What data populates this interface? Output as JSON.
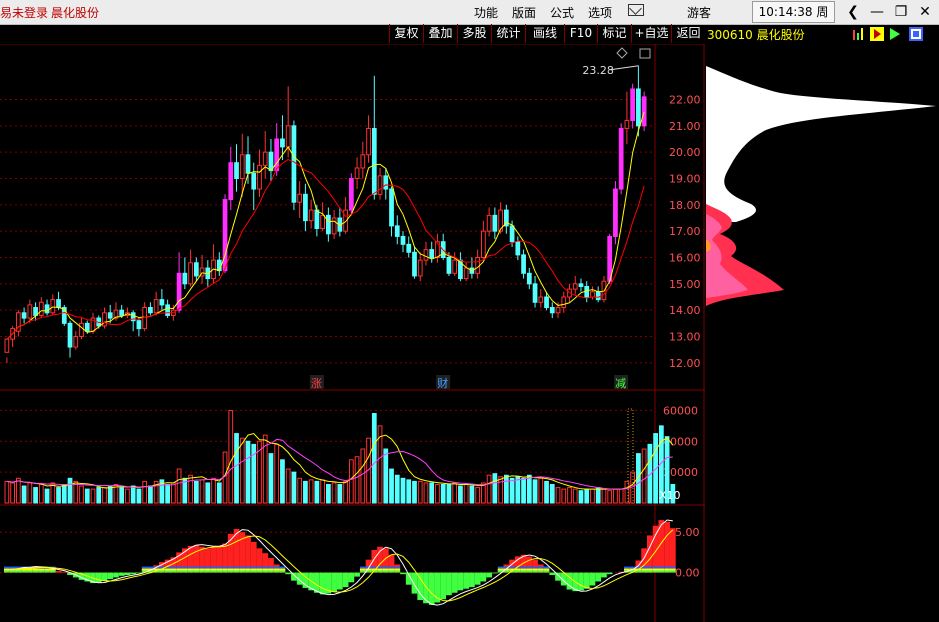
{
  "titlebar": {
    "login_text": "易未登录",
    "stock_name": "晨化股份",
    "menu": [
      "功能",
      "版面",
      "公式",
      "选项"
    ],
    "guest": "游客",
    "time": "10:14:38",
    "weekday": "周五"
  },
  "toolbar": {
    "buttons": [
      "复权",
      "叠加",
      "多股",
      "统计",
      "画线",
      "F10",
      "标记",
      "+自选",
      "返回"
    ]
  },
  "right_panel": {
    "code": "300610",
    "name": "晨化股份"
  },
  "price_axis": {
    "labels": [
      "22.00",
      "21.00",
      "20.00",
      "19.00",
      "18.00",
      "17.00",
      "16.00",
      "15.00",
      "14.00",
      "13.00",
      "12.00"
    ]
  },
  "max_price_label": "23.28",
  "event_markers": [
    {
      "text": "涨",
      "color": "#ff4040"
    },
    {
      "text": "财",
      "color": "#40a0ff"
    },
    {
      "text": "减",
      "color": "#40ff40"
    }
  ],
  "volume_axis": {
    "labels": [
      "60000",
      "40000",
      "20000"
    ],
    "unit": "X10"
  },
  "macd_axis": {
    "labels": [
      "5.00",
      "0.00"
    ]
  },
  "colors": {
    "up": "#ff3232",
    "up_fill_big": "#ff30ff",
    "down": "#54ffff",
    "ma5": "#ffff00",
    "ma10": "#ff0000",
    "vol_ma1": "#ffff00",
    "vol_ma2": "#ff40ff",
    "grid": "#800000"
  },
  "chart_data": [
    {
      "type": "candlestick",
      "title": "",
      "ylim": [
        11.5,
        23.5
      ],
      "series": [
        {
          "name": "",
          "values": [
            [
              12.4,
              12.9,
              12.2,
              12.0
            ],
            [
              12.9,
              13.3,
              12.6,
              13.4
            ],
            [
              13.2,
              13.9,
              13.0,
              14.0
            ],
            [
              13.9,
              13.7,
              13.5,
              14.1
            ],
            [
              13.7,
              14.2,
              13.5,
              14.4
            ],
            [
              14.1,
              13.8,
              13.6,
              14.3
            ],
            [
              13.8,
              14.3,
              13.7,
              14.5
            ],
            [
              14.2,
              13.9,
              13.8,
              14.4
            ],
            [
              13.9,
              14.4,
              13.8,
              14.6
            ],
            [
              14.4,
              14.1,
              14.0,
              14.7
            ],
            [
              14.1,
              13.5,
              13.4,
              14.2
            ],
            [
              13.5,
              12.6,
              12.2,
              13.6
            ],
            [
              12.6,
              13.0,
              12.5,
              13.2
            ],
            [
              13.0,
              13.5,
              12.9,
              13.7
            ],
            [
              13.5,
              13.2,
              13.1,
              13.6
            ],
            [
              13.2,
              13.7,
              13.1,
              13.9
            ],
            [
              13.7,
              13.4,
              13.3,
              13.8
            ],
            [
              13.4,
              13.9,
              13.3,
              14.1
            ],
            [
              13.9,
              13.7,
              13.5,
              14.2
            ],
            [
              13.7,
              14.0,
              13.6,
              14.3
            ],
            [
              14.0,
              13.8,
              13.7,
              14.2
            ],
            [
              13.8,
              13.9,
              13.7,
              14.1
            ],
            [
              13.9,
              13.6,
              13.2,
              14.0
            ],
            [
              13.6,
              13.3,
              13.0,
              13.7
            ],
            [
              13.3,
              14.1,
              13.2,
              14.3
            ],
            [
              14.1,
              13.9,
              13.8,
              14.3
            ],
            [
              13.9,
              14.4,
              13.8,
              14.7
            ],
            [
              14.4,
              14.2,
              14.0,
              14.8
            ],
            [
              14.2,
              13.8,
              13.7,
              14.4
            ],
            [
              13.8,
              14.0,
              13.6,
              14.2
            ],
            [
              14.0,
              15.4,
              13.9,
              16.2
            ],
            [
              15.4,
              15.0,
              14.8,
              16.0
            ],
            [
              15.0,
              15.8,
              14.9,
              16.3
            ],
            [
              15.8,
              15.3,
              15.1,
              16.0
            ],
            [
              15.3,
              15.6,
              15.0,
              16.1
            ],
            [
              15.6,
              15.2,
              14.9,
              15.9
            ],
            [
              15.2,
              15.9,
              15.0,
              16.5
            ],
            [
              15.9,
              15.5,
              15.3,
              16.2
            ],
            [
              15.5,
              18.2,
              15.4,
              18.4
            ],
            [
              18.2,
              19.6,
              17.8,
              20.2
            ],
            [
              19.6,
              19.0,
              18.5,
              20.3
            ],
            [
              19.0,
              19.9,
              18.3,
              20.7
            ],
            [
              19.9,
              19.2,
              18.8,
              20.6
            ],
            [
              19.2,
              18.6,
              17.8,
              19.6
            ],
            [
              18.6,
              19.5,
              18.3,
              20.1
            ],
            [
              19.5,
              20.0,
              19.0,
              20.8
            ],
            [
              20.0,
              19.3,
              18.9,
              20.5
            ],
            [
              19.3,
              20.5,
              19.1,
              21.1
            ],
            [
              20.5,
              20.2,
              19.7,
              21.4
            ],
            [
              20.2,
              21.0,
              19.8,
              22.5
            ],
            [
              21.0,
              18.1,
              17.8,
              21.2
            ],
            [
              18.1,
              18.4,
              17.5,
              18.9
            ],
            [
              18.4,
              17.4,
              17.0,
              18.8
            ],
            [
              17.4,
              17.8,
              17.1,
              18.2
            ],
            [
              17.8,
              17.1,
              16.8,
              18.0
            ],
            [
              17.1,
              17.6,
              17.0,
              18.1
            ],
            [
              17.6,
              16.9,
              16.6,
              17.9
            ],
            [
              16.9,
              17.5,
              16.7,
              17.8
            ],
            [
              17.5,
              17.0,
              16.8,
              17.9
            ],
            [
              17.0,
              17.8,
              16.9,
              18.3
            ],
            [
              17.8,
              19.0,
              17.6,
              19.2
            ],
            [
              19.0,
              19.4,
              18.6,
              19.8
            ],
            [
              19.4,
              19.9,
              19.0,
              20.4
            ],
            [
              19.9,
              20.9,
              19.6,
              21.4
            ],
            [
              20.9,
              18.4,
              18.2,
              22.9
            ],
            [
              18.4,
              19.1,
              18.2,
              19.4
            ],
            [
              19.1,
              18.6,
              18.2,
              19.4
            ],
            [
              18.6,
              17.2,
              16.8,
              18.7
            ],
            [
              17.2,
              16.8,
              16.5,
              17.6
            ],
            [
              16.8,
              16.5,
              16.2,
              17.0
            ],
            [
              16.5,
              16.2,
              16.0,
              16.8
            ],
            [
              16.2,
              15.3,
              15.2,
              16.4
            ],
            [
              15.3,
              15.9,
              15.1,
              16.2
            ],
            [
              15.9,
              16.3,
              15.7,
              16.6
            ],
            [
              16.3,
              16.0,
              15.8,
              16.6
            ],
            [
              16.0,
              16.6,
              15.8,
              16.9
            ],
            [
              16.6,
              16.0,
              15.9,
              16.9
            ],
            [
              16.0,
              15.4,
              15.3,
              16.2
            ],
            [
              15.4,
              15.9,
              15.3,
              16.2
            ],
            [
              15.9,
              15.2,
              15.1,
              16.2
            ],
            [
              15.2,
              15.6,
              15.1,
              15.8
            ],
            [
              15.6,
              15.4,
              15.2,
              16.0
            ],
            [
              15.4,
              16.0,
              15.2,
              16.3
            ],
            [
              16.0,
              17.0,
              15.9,
              17.4
            ],
            [
              17.0,
              17.6,
              16.8,
              17.9
            ],
            [
              17.6,
              17.0,
              16.7,
              17.9
            ],
            [
              17.0,
              17.8,
              16.9,
              18.1
            ],
            [
              17.8,
              17.2,
              16.9,
              18.0
            ],
            [
              17.2,
              16.6,
              16.4,
              17.4
            ],
            [
              16.6,
              16.1,
              15.9,
              16.8
            ],
            [
              16.1,
              15.4,
              15.2,
              16.3
            ],
            [
              15.4,
              15.0,
              14.8,
              15.6
            ],
            [
              15.0,
              14.3,
              14.1,
              15.3
            ],
            [
              14.3,
              14.5,
              14.1,
              14.8
            ],
            [
              14.5,
              14.1,
              14.0,
              14.7
            ],
            [
              14.1,
              13.9,
              13.7,
              14.3
            ],
            [
              13.9,
              14.1,
              13.7,
              14.3
            ],
            [
              14.1,
              14.5,
              13.9,
              14.7
            ],
            [
              14.5,
              14.8,
              14.3,
              15.0
            ],
            [
              14.8,
              15.0,
              14.6,
              15.3
            ],
            [
              15.0,
              14.9,
              14.7,
              15.2
            ],
            [
              14.9,
              14.5,
              14.3,
              15.1
            ],
            [
              14.5,
              14.7,
              14.4,
              14.9
            ],
            [
              14.7,
              14.4,
              14.3,
              14.9
            ],
            [
              14.4,
              15.1,
              14.3,
              15.3
            ],
            [
              15.1,
              16.8,
              15.0,
              16.9
            ],
            [
              16.8,
              18.6,
              16.5,
              18.9
            ],
            [
              18.6,
              20.9,
              18.4,
              21.1
            ],
            [
              20.9,
              21.2,
              20.3,
              22.3
            ],
            [
              21.2,
              22.4,
              20.9,
              22.6
            ],
            [
              22.4,
              21.0,
              20.6,
              23.28
            ],
            [
              21.0,
              22.1,
              20.8,
              22.3
            ]
          ]
        },
        {
          "name": "",
          "values": []
        },
        {
          "name": "",
          "values": []
        }
      ]
    },
    {
      "type": "bar",
      "title": "",
      "unit": "X10",
      "ylim": [
        0,
        70000
      ],
      "values": [
        14000,
        13000,
        16000,
        11000,
        13000,
        10000,
        12000,
        9000,
        13000,
        10000,
        12000,
        16000,
        14000,
        11000,
        9000,
        9000,
        10000,
        10000,
        11000,
        12000,
        10000,
        9000,
        11000,
        9000,
        14000,
        11000,
        14000,
        15000,
        12000,
        13000,
        22000,
        16000,
        18000,
        14000,
        15000,
        13000,
        16000,
        13000,
        33000,
        60000,
        45000,
        42000,
        40000,
        38000,
        40000,
        44000,
        32000,
        38000,
        28000,
        22000,
        20000,
        16000,
        14000,
        15000,
        14000,
        15000,
        12000,
        13000,
        12000,
        14000,
        28000,
        30000,
        35000,
        42000,
        58000,
        50000,
        35000,
        22000,
        18000,
        16000,
        15000,
        14000,
        14000,
        13000,
        13000,
        12000,
        12000,
        12000,
        13000,
        11000,
        12000,
        11000,
        10000,
        13000,
        18000,
        19000,
        17000,
        18000,
        16000,
        17000,
        16000,
        18000,
        15000,
        16000,
        14000,
        12000,
        10000,
        9000,
        10000,
        9000,
        8000,
        9000,
        9000,
        10000,
        9000,
        8000,
        9000,
        9000,
        14000,
        20000,
        32000,
        35000,
        38000,
        45000,
        50000,
        43000,
        12000
      ],
      "up": [
        1,
        1,
        1,
        0,
        1,
        0,
        1,
        0,
        1,
        0,
        0,
        0,
        1,
        1,
        0,
        1,
        0,
        1,
        0,
        1,
        0,
        1,
        0,
        0,
        1,
        0,
        1,
        0,
        0,
        1,
        1,
        0,
        1,
        0,
        1,
        0,
        1,
        0,
        1,
        1,
        0,
        1,
        0,
        0,
        1,
        1,
        0,
        1,
        0,
        1,
        0,
        1,
        0,
        1,
        0,
        1,
        0,
        1,
        0,
        1,
        1,
        1,
        1,
        1,
        0,
        1,
        0,
        0,
        0,
        0,
        0,
        0,
        1,
        1,
        0,
        1,
        0,
        0,
        1,
        0,
        1,
        0,
        1,
        1,
        1,
        0,
        1,
        0,
        0,
        0,
        0,
        0,
        0,
        1,
        0,
        0,
        1,
        1,
        1,
        1,
        0,
        0,
        1,
        0,
        1,
        1,
        1,
        1,
        1,
        1,
        0,
        1
      ]
    },
    {
      "type": "bar",
      "title": "",
      "ylim": [
        -5.5,
        7.5
      ],
      "values": [
        0.3,
        0.5,
        0.6,
        0.7,
        0.6,
        0.8,
        0.6,
        0.5,
        0.4,
        0.2,
        0.1,
        -0.3,
        -0.6,
        -0.9,
        -1.1,
        -1.3,
        -1.2,
        -1.0,
        -0.8,
        -0.6,
        -0.4,
        -0.3,
        -0.2,
        -0.1,
        0.3,
        0.6,
        0.9,
        1.3,
        1.6,
        1.9,
        2.5,
        3.0,
        3.3,
        3.4,
        3.2,
        3.0,
        3.1,
        3.2,
        3.6,
        4.8,
        5.4,
        5.0,
        4.6,
        3.8,
        3.0,
        2.4,
        1.8,
        1.0,
        0.4,
        -0.2,
        -1.0,
        -1.5,
        -1.9,
        -2.2,
        -2.5,
        -2.7,
        -2.6,
        -2.4,
        -2.1,
        -1.8,
        -1.2,
        -0.5,
        0.5,
        1.6,
        2.8,
        3.2,
        3.0,
        2.2,
        1.0,
        -0.2,
        -1.5,
        -2.6,
        -3.4,
        -3.8,
        -4.0,
        -3.7,
        -3.3,
        -2.8,
        -2.5,
        -2.2,
        -2.0,
        -1.8,
        -1.5,
        -1.1,
        -0.6,
        -0.1,
        0.4,
        1.0,
        1.6,
        2.0,
        2.2,
        2.0,
        1.6,
        1.0,
        0.4,
        -0.3,
        -1.0,
        -1.6,
        -2.1,
        -2.3,
        -2.2,
        -2.0,
        -1.6,
        -1.1,
        -0.6,
        -0.2,
        0.0,
        0.1,
        0.3,
        0.6,
        1.5,
        3.0,
        4.6,
        5.8,
        6.5,
        6.3,
        5.5
      ]
    }
  ]
}
